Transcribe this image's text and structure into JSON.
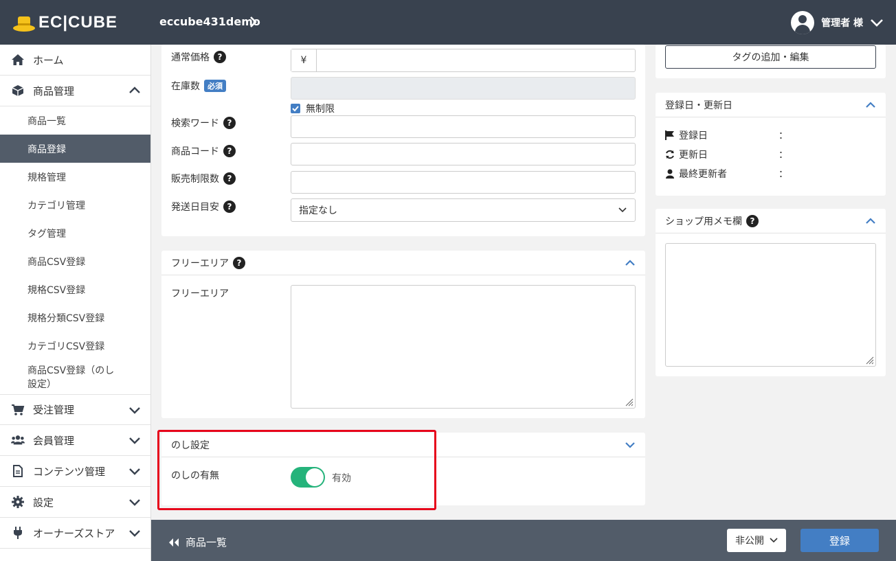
{
  "header": {
    "logo_text": "EC|CUBE",
    "shop_name": "eccube431demo",
    "user_name": "管理者 様"
  },
  "sidebar": {
    "home": "ホーム",
    "product": "商品管理",
    "product_items": [
      "商品一覧",
      "商品登録",
      "規格管理",
      "カテゴリ管理",
      "タグ管理",
      "商品CSV登録",
      "規格CSV登録",
      "規格分類CSV登録",
      "カテゴリCSV登録",
      "商品CSV登録（のし設定）"
    ],
    "order": "受注管理",
    "customer": "会員管理",
    "content": "コンテンツ管理",
    "setting": "設定",
    "store": "オーナーズストア"
  },
  "form": {
    "price_label": "通常価格",
    "currency": "¥",
    "stock_label": "在庫数",
    "required": "必須",
    "unlimited": "無制限",
    "search_word_label": "検索ワード",
    "product_code_label": "商品コード",
    "sale_limit_label": "販売制限数",
    "delivery_label": "発送日目安",
    "delivery_value": "指定なし"
  },
  "free_area": {
    "title": "フリーエリア",
    "label": "フリーエリア"
  },
  "noshi": {
    "title": "のし設定",
    "label": "のしの有無",
    "status": "有効"
  },
  "right": {
    "tag_button": "タグの追加・編集",
    "dates_title": "登録日・更新日",
    "registered": "登録日",
    "updated": "更新日",
    "last_editor": "最終更新者",
    "colon": "：",
    "memo_title": "ショップ用メモ欄"
  },
  "footer": {
    "back_label": "商品一覧",
    "visibility": "非公開",
    "submit": "登録"
  },
  "colors": {
    "header": "#39424f",
    "accent": "#437ec4",
    "toggle_on": "#25b37b",
    "highlight": "#e6001a"
  }
}
